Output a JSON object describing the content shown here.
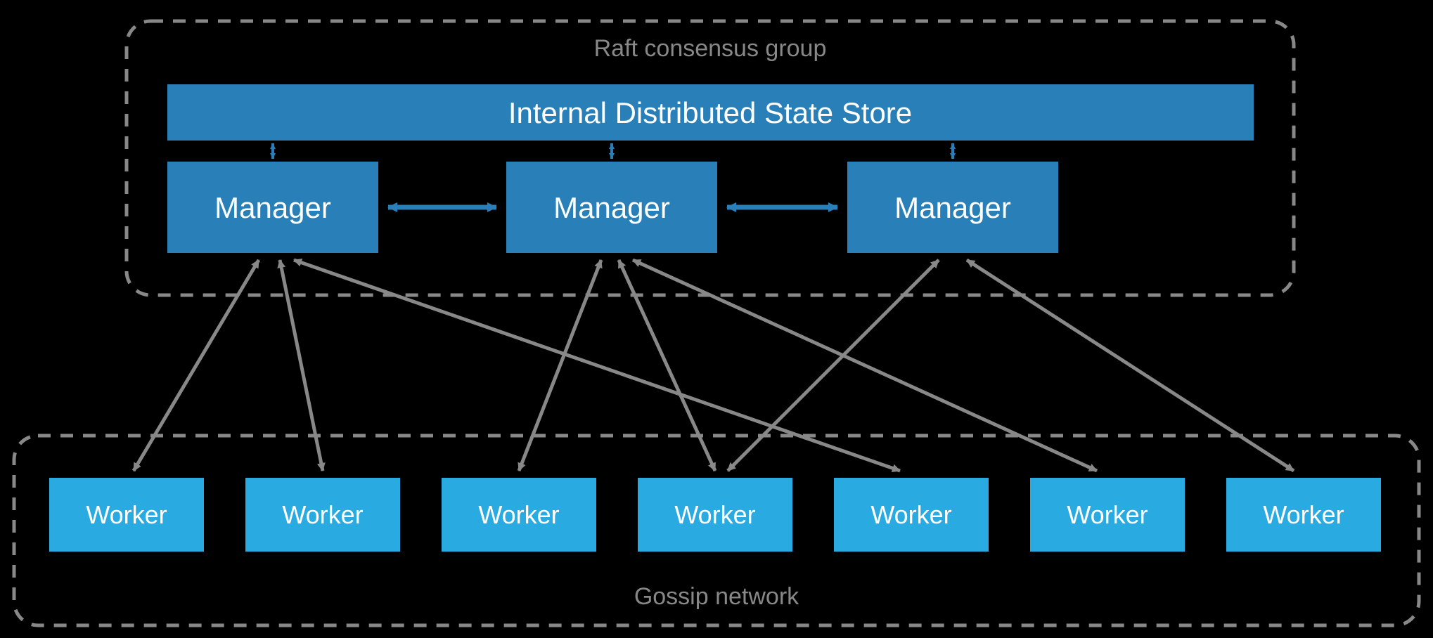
{
  "groups": {
    "raft": {
      "label": "Raft consensus group"
    },
    "gossip": {
      "label": "Gossip network"
    }
  },
  "stateStore": {
    "label": "Internal Distributed State Store"
  },
  "managers": [
    {
      "label": "Manager"
    },
    {
      "label": "Manager"
    },
    {
      "label": "Manager"
    }
  ],
  "workers": [
    {
      "label": "Worker"
    },
    {
      "label": "Worker"
    },
    {
      "label": "Worker"
    },
    {
      "label": "Worker"
    },
    {
      "label": "Worker"
    },
    {
      "label": "Worker"
    },
    {
      "label": "Worker"
    }
  ],
  "colors": {
    "manager": "#2980b9",
    "stateStore": "#2980b9",
    "worker": "#29abe2",
    "border": "#888",
    "arrow": "#888",
    "blueArrow": "#2980b9"
  }
}
